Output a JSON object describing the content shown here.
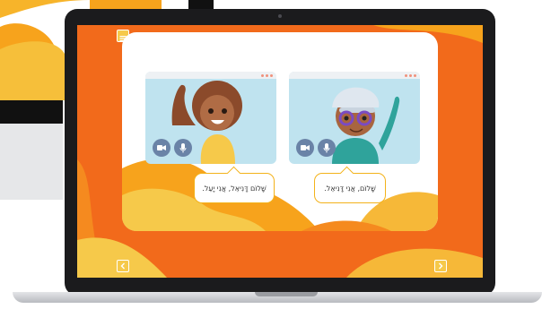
{
  "colors": {
    "screen_orange": "#f26a1b",
    "accent_yellow": "#f6c94a",
    "wave_orange": "#f7a31c",
    "video_bg": "#bfe3ef",
    "control_blue": "#6a83a7",
    "bubble_border": "#f3b21a"
  },
  "icons": {
    "menu": "menu-icon",
    "prev": "chevron-left-icon",
    "next": "chevron-right-icon",
    "camera": "video-camera-icon",
    "mic": "microphone-icon"
  },
  "lesson": {
    "left_bubble": "שָׁלוֹם דָּנִיאֵל, אֲנִי יָעֵל.",
    "right_bubble": "שָׁלוֹם, אֲנִי דָּנִיאֵל."
  }
}
